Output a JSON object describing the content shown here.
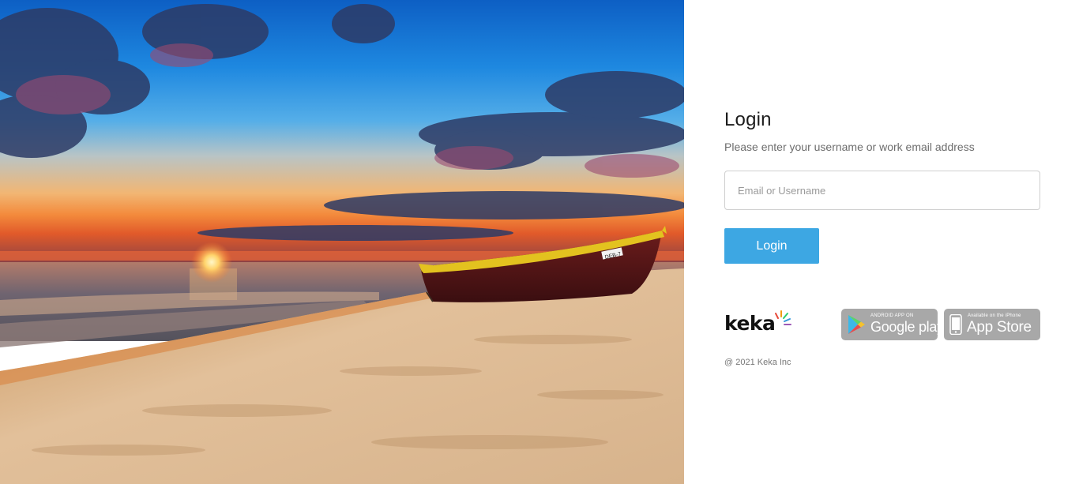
{
  "login": {
    "title": "Login",
    "subtitle": "Please enter your username or work email address",
    "email_placeholder": "Email or Username",
    "email_value": "",
    "button_label": "Login"
  },
  "brand": {
    "name": "keka",
    "text_color": "#111111",
    "accent_colors": [
      "#e74c3c",
      "#f39c12",
      "#2ecc71",
      "#3498db",
      "#9b59b6"
    ]
  },
  "stores": {
    "google": {
      "small_text": "ANDROID APP ON",
      "big_text": "Google play",
      "icon": "google-play-icon"
    },
    "apple": {
      "small_text": "Available on the iPhone",
      "big_text": "App Store",
      "icon": "iphone-icon"
    }
  },
  "footer": {
    "copyright": "@ 2021 Keka Inc"
  },
  "colors": {
    "button": "#3da7e3",
    "badge": "#a8a8a8",
    "input_border": "#cfcfcf"
  },
  "hero": {
    "image": "beach-sunset-boat-photo",
    "boat_label": "DEB-7"
  }
}
